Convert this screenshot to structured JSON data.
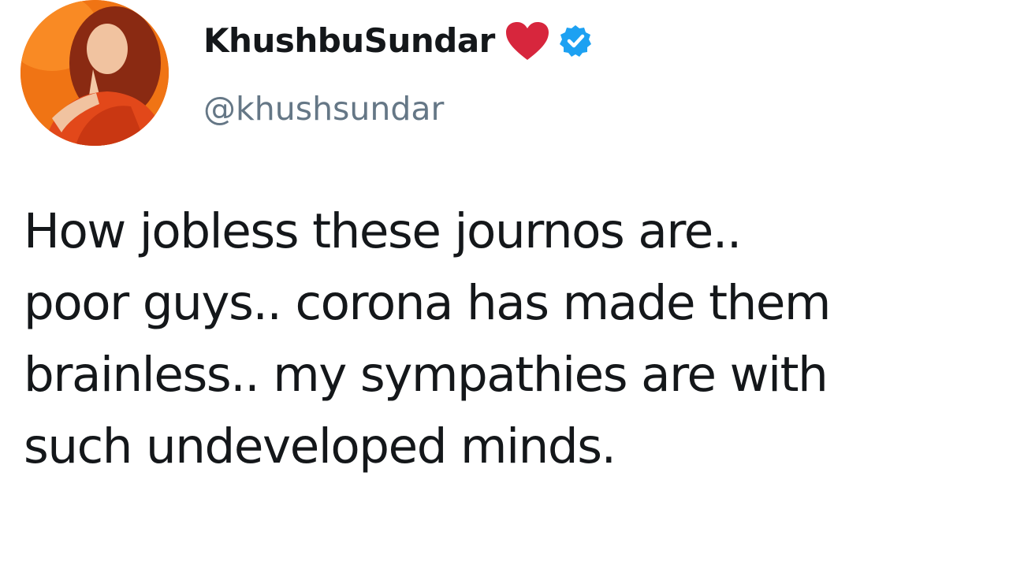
{
  "author": {
    "display_name": "KhushbuSundar",
    "handle": "@khushsundar",
    "name_emoji": "heart-icon",
    "verified_badge": "verified-icon"
  },
  "tweet": {
    "lines": [
      "How jobless these journos are..",
      "poor guys.. corona has made them",
      "brainless.. my sympathies are with",
      "such undeveloped minds."
    ]
  },
  "colors": {
    "name": "#14171a",
    "handle": "#657786",
    "heart": "#d7263d",
    "verified": "#1da1f2",
    "avatar_background": "#f26a0e"
  }
}
